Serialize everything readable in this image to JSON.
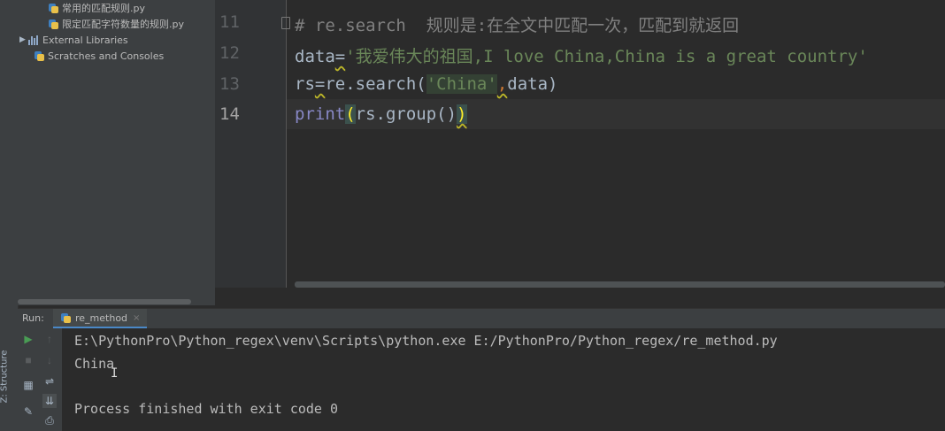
{
  "project_tree": {
    "items": [
      {
        "label": "常用的匹配规则.py",
        "icon": "python-file-icon"
      },
      {
        "label": "限定匹配字符数量的规则.py",
        "icon": "python-file-icon"
      },
      {
        "label": "External Libraries",
        "icon": "library-icon"
      },
      {
        "label": "Scratches and Consoles",
        "icon": "scratch-icon"
      }
    ]
  },
  "side_tab": {
    "structure_label": "Z: Structure"
  },
  "editor": {
    "line_numbers": [
      "11",
      "12",
      "13",
      "14"
    ],
    "line11": {
      "comment": "# re.search  规则是:在全文中匹配一次，匹配到就返回"
    },
    "line12": {
      "var": "data",
      "op": "=",
      "string": "'我爱伟大的祖国,I love China,China is a great country'"
    },
    "line13": {
      "var": "rs",
      "op": "=",
      "call": "re.search(",
      "string": "'China'",
      "comma": ",",
      "rest": "data)"
    },
    "line14": {
      "func": "print",
      "open": "(",
      "mid": "rs.group()",
      "close": ")"
    }
  },
  "run_panel": {
    "label": "Run:",
    "tab_label": "re_method",
    "tab_close": "×",
    "output": [
      "E:\\PythonPro\\Python_regex\\venv\\Scripts\\python.exe E:/PythonPro/Python_regex/re_method.py",
      "China",
      "",
      "Process finished with exit code 0"
    ]
  },
  "colors": {
    "editor_bg": "#2b2b2b",
    "panel_bg": "#3c3f41",
    "keyword": "#cc7832",
    "string": "#6a8759",
    "comment": "#808080",
    "builtin": "#8888c6",
    "run_green": "#499c54"
  }
}
